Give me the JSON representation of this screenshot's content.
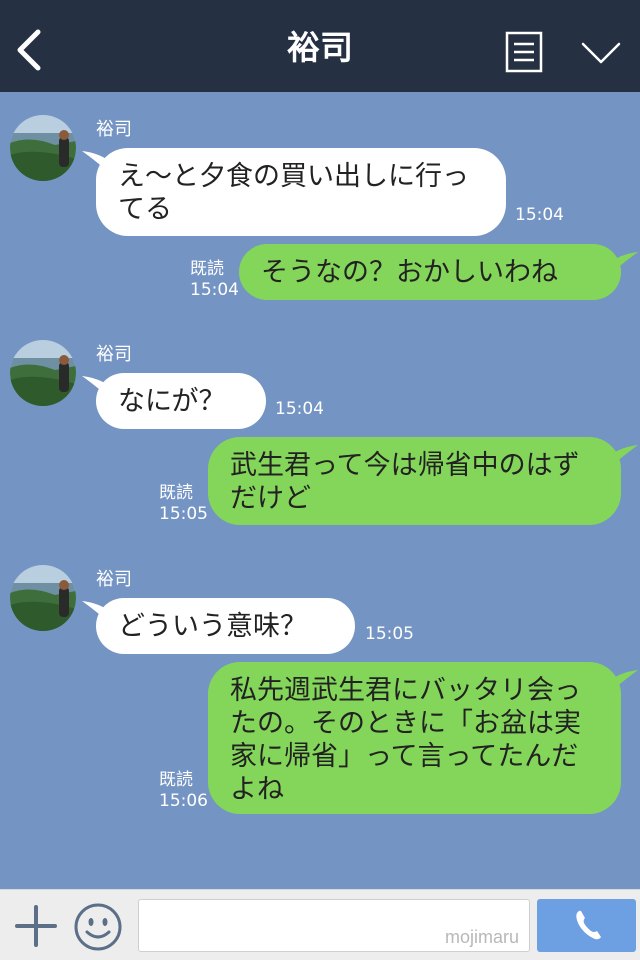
{
  "header": {
    "title": "裕司"
  },
  "messages": [
    {
      "type": "in",
      "sender": "裕司",
      "text": "え〜と夕食の買い出しに行ってる",
      "time": "15:04"
    },
    {
      "type": "out",
      "read": "既読",
      "text": "そうなの？おかしいわね",
      "time": "15:04"
    },
    {
      "type": "in",
      "sender": "裕司",
      "text": "なにが？",
      "time": "15:04"
    },
    {
      "type": "out",
      "read": "既読",
      "text": "武生君って今は帰省中のはずだけど",
      "time": "15:05"
    },
    {
      "type": "in",
      "sender": "裕司",
      "text": "どういう意味？",
      "time": "15:05"
    },
    {
      "type": "out",
      "read": "既読",
      "text": "私先週武生君にバッタリ会ったの。そのときに「お盆は実家に帰省」って言ってたんだよね",
      "time": "15:06"
    }
  ],
  "input": {
    "placeholder": "",
    "watermark": "mojimaru"
  },
  "colors": {
    "header_bg": "#253043",
    "chat_bg": "#7494c3",
    "incoming_bubble": "#ffffff",
    "outgoing_bubble": "#84d65a",
    "call_button": "#6d9fe3"
  },
  "icons": {
    "back": "chevron-left-icon",
    "menu": "menu-lines-icon",
    "collapse": "chevron-down-icon",
    "plus": "plus-icon",
    "emoji": "smiley-icon",
    "call": "phone-icon"
  }
}
